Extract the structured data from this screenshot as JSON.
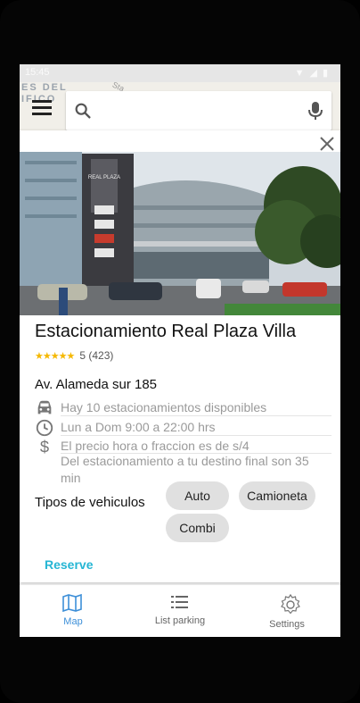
{
  "status_bar": {
    "time": "15:45",
    "icons": [
      "wifi-icon",
      "signal-icon",
      "battery-icon"
    ]
  },
  "map": {
    "label_lines": [
      "ES DEL",
      "IFICO"
    ],
    "street": "Sta"
  },
  "search": {
    "placeholder": ""
  },
  "parking": {
    "name": "Estacionamiento Real Plaza Villa",
    "rating_value": "5",
    "rating_count": "(423)",
    "address": "Av. Alameda sur 185",
    "availability": "Hay 10 estacionamientos disponibles",
    "hours": "Lun a Dom 9:00 a 22:00 hrs",
    "price": "El precio hora  o fraccion  es de s/4",
    "distance": "Del estacionamiento  a tu destino final son 35 min",
    "vehicle_types_label": "Tipos de  vehiculos",
    "vehicle_types": [
      "Auto",
      "Camioneta",
      "Combi"
    ],
    "photo_signage": "REAL PLAZA",
    "reserve_label": "Reserve"
  },
  "bottom_nav": [
    {
      "label": "Map",
      "icon": "map-icon",
      "active": true
    },
    {
      "label": "List parking",
      "icon": "list-icon",
      "active": false
    },
    {
      "label": "Settings",
      "icon": "settings-icon",
      "active": false
    }
  ],
  "colors": {
    "accent": "#26b6d4",
    "nav_active": "#3d8fd8",
    "star": "#f5b800",
    "chip": "#e0e0e0"
  }
}
